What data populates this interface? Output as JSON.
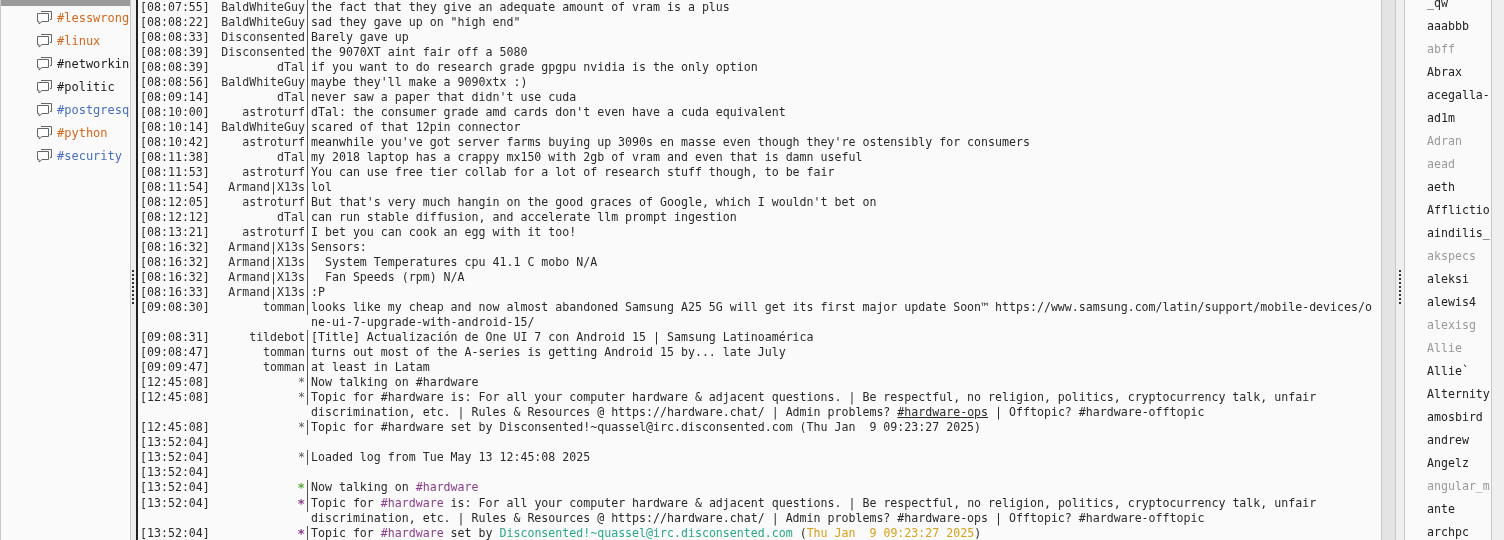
{
  "channels": [
    {
      "name": "#lesswrong",
      "color": "#d4681c"
    },
    {
      "name": "#linux",
      "color": "#d4681c"
    },
    {
      "name": "#networkin",
      "color": "#222222"
    },
    {
      "name": "#politic",
      "color": "#222222"
    },
    {
      "name": "#postgresq",
      "color": "#4a6fc0"
    },
    {
      "name": "#python",
      "color": "#d4681c"
    },
    {
      "name": "#security",
      "color": "#4a6fc0"
    }
  ],
  "messages": [
    {
      "time": "[08:07:55]",
      "nick": "BaldWhiteGuy",
      "lines": [
        "the fact that they give an adequate amount of vram is a plus"
      ]
    },
    {
      "time": "[08:08:22]",
      "nick": "BaldWhiteGuy",
      "lines": [
        "sad they gave up on \"high end\""
      ]
    },
    {
      "time": "[08:08:33]",
      "nick": "Disconsented",
      "lines": [
        "Barely gave up"
      ]
    },
    {
      "time": "[08:08:39]",
      "nick": "Disconsented",
      "lines": [
        "the 9070XT aint fair off a 5080"
      ]
    },
    {
      "time": "[08:08:39]",
      "nick": "dTal",
      "lines": [
        "if you want to do research grade gpgpu nvidia is the only option"
      ]
    },
    {
      "time": "[08:08:56]",
      "nick": "BaldWhiteGuy",
      "lines": [
        "maybe they'll make a 9090xtx :)"
      ]
    },
    {
      "time": "[08:09:14]",
      "nick": "dTal",
      "lines": [
        "never saw a paper that didn't use cuda"
      ]
    },
    {
      "time": "[08:10:00]",
      "nick": "astroturf",
      "lines": [
        "dTal: the consumer grade amd cards don't even have a cuda equivalent"
      ]
    },
    {
      "time": "[08:10:14]",
      "nick": "BaldWhiteGuy",
      "lines": [
        "scared of that 12pin connector"
      ]
    },
    {
      "time": "[08:10:42]",
      "nick": "astroturf",
      "lines": [
        "meanwhile you've got server farms buying up 3090s en masse even though they're ostensibly for consumers"
      ]
    },
    {
      "time": "[08:11:38]",
      "nick": "dTal",
      "lines": [
        "my 2018 laptop has a crappy mx150 with 2gb of vram and even that is damn useful"
      ]
    },
    {
      "time": "[08:11:53]",
      "nick": "astroturf",
      "lines": [
        "You can use free tier collab for a lot of research stuff though, to be fair"
      ]
    },
    {
      "time": "[08:11:54]",
      "nick": "Armand|X13s",
      "lines": [
        "lol"
      ]
    },
    {
      "time": "[08:12:05]",
      "nick": "astroturf",
      "lines": [
        "But that's very much hangin on the good graces of Google, which I wouldn't bet on"
      ]
    },
    {
      "time": "[08:12:12]",
      "nick": "dTal",
      "lines": [
        "can run stable diffusion, and accelerate llm prompt ingestion"
      ]
    },
    {
      "time": "[08:13:21]",
      "nick": "astroturf",
      "lines": [
        "I bet you can cook an egg with it too!"
      ]
    },
    {
      "time": "[08:16:32]",
      "nick": "Armand|X13s",
      "lines": [
        "Sensors:"
      ]
    },
    {
      "time": "[08:16:32]",
      "nick": "Armand|X13s",
      "lines": [
        "  System Temperatures cpu 41.1 C mobo N/A"
      ]
    },
    {
      "time": "[08:16:32]",
      "nick": "Armand|X13s",
      "lines": [
        "  Fan Speeds (rpm) N/A"
      ]
    },
    {
      "time": "[08:16:33]",
      "nick": "Armand|X13s",
      "lines": [
        ":P"
      ]
    },
    {
      "time": "[09:08:30]",
      "nick": "tomman",
      "lines": [
        "looks like my cheap and now almost abandoned Samsung A25 5G will get its first major update Soon™ https://www.samsung.com/latin/support/mobile-devices/o",
        "ne-ui-7-upgrade-with-android-15/"
      ]
    },
    {
      "time": "[09:08:31]",
      "nick": "tildebot",
      "lines": [
        "[Title] Actualización de One UI 7 con Android 15 | Samsung Latinoamérica"
      ]
    },
    {
      "time": "[09:08:47]",
      "nick": "tomman",
      "lines": [
        "turns out most of the A-series is getting Android 15 by... late July"
      ]
    },
    {
      "time": "[09:09:47]",
      "nick": "tomman",
      "lines": [
        "at least in Latam"
      ]
    },
    {
      "time": "[12:45:08]",
      "nick": "*",
      "lines": [
        "Now talking on #hardware"
      ]
    },
    {
      "time": "[12:45:08]",
      "nick": "*",
      "lines": [
        "Topic for #hardware is: For all your computer hardware & adjacent questions. | Be respectful, no religion, politics, cryptocurrency talk, unfair",
        [
          {
            "text": "discrimination, etc. | Rules & Resources @ https://hardware.chat/ | Admin problems? "
          },
          {
            "text": "#hardware-ops",
            "underline": true
          },
          {
            "text": " | Offtopic? #hardware-offtopic"
          }
        ]
      ]
    },
    {
      "time": "[12:45:08]",
      "nick": "*",
      "lines": [
        "Topic for #hardware set by Disconsented!~quassel@irc.disconsented.com (Thu Jan  9 09:23:27 2025)"
      ]
    },
    {
      "time": "[13:52:04]"
    },
    {
      "time": "[13:52:04]",
      "nick": "*",
      "lines": [
        "Loaded log from Tue May 13 12:45:08 2025"
      ]
    },
    {
      "time": "[13:52:04]"
    },
    {
      "time": "[13:52:04]",
      "nick": "*",
      "color": "#5aac3a",
      "lines": [
        [
          {
            "text": "Now talking on "
          },
          {
            "text": "#hardware",
            "color": "#8b3f8b"
          }
        ]
      ]
    },
    {
      "time": "[13:52:04]",
      "nick": "*",
      "color": "#8b3f8b",
      "lines": [
        [
          {
            "text": "Topic for "
          },
          {
            "text": "#hardware",
            "color": "#8b3f8b"
          },
          {
            "text": " is: For all your computer hardware & adjacent questions. | Be respectful, no religion, politics, cryptocurrency talk, unfair"
          }
        ],
        "discrimination, etc. | Rules & Resources @ https://hardware.chat/ | Admin problems? #hardware-ops | Offtopic? #hardware-offtopic"
      ]
    },
    {
      "time": "[13:52:04]",
      "nick": "*",
      "color": "#8b3f8b",
      "lines": [
        [
          {
            "text": "Topic for "
          },
          {
            "text": "#hardware",
            "color": "#8b3f8b"
          },
          {
            "text": " set by "
          },
          {
            "text": "Disconsented!~quassel@irc.disconsented.com",
            "color": "#2aa88a"
          },
          {
            "text": " ("
          },
          {
            "text": "Thu Jan  9 09:23:27 2025",
            "color": "#d6a21a"
          },
          {
            "text": ")"
          }
        ]
      ]
    }
  ],
  "nicks": [
    {
      "name": "_qw",
      "away": false
    },
    {
      "name": "aaabbb",
      "away": false
    },
    {
      "name": "abff",
      "away": true
    },
    {
      "name": "Abrax",
      "away": false
    },
    {
      "name": "acegalla-",
      "away": false
    },
    {
      "name": "ad1m",
      "away": false
    },
    {
      "name": "Adran",
      "away": true
    },
    {
      "name": "aead",
      "away": true
    },
    {
      "name": "aeth",
      "away": false
    },
    {
      "name": "Afflictio",
      "away": false
    },
    {
      "name": "aindilis_",
      "away": false
    },
    {
      "name": "akspecs",
      "away": true
    },
    {
      "name": "aleksi",
      "away": false
    },
    {
      "name": "alewis4",
      "away": false
    },
    {
      "name": "alexisg",
      "away": true
    },
    {
      "name": "Allie",
      "away": true
    },
    {
      "name": "Allie`",
      "away": false
    },
    {
      "name": "Alternity",
      "away": false
    },
    {
      "name": "amosbird",
      "away": false
    },
    {
      "name": "andrew",
      "away": false
    },
    {
      "name": "Angelz",
      "away": false
    },
    {
      "name": "angular_m",
      "away": true
    },
    {
      "name": "ante",
      "away": false
    },
    {
      "name": "archpc",
      "away": false
    }
  ]
}
